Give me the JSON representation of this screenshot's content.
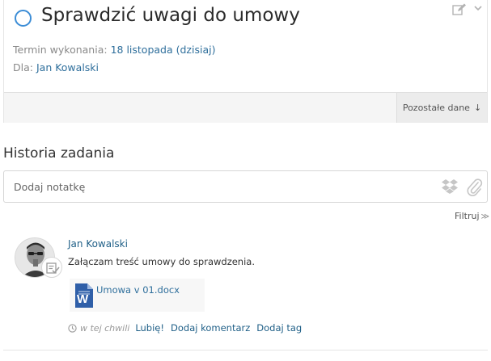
{
  "task": {
    "title": "Sprawdzić uwagi do umowy",
    "due_label": "Termin wykonania:",
    "due_value": "18 listopada (dzisiaj)",
    "for_label": "Dla:",
    "for_value": "Jan Kowalski",
    "more_data_label": "Pozostałe dane",
    "more_data_arrow": "↓"
  },
  "history": {
    "title": "Historia zadania",
    "note_placeholder": "Dodaj notatkę",
    "filter_label": "Filtruj",
    "filter_chevron": "≫"
  },
  "entry": {
    "author": "Jan Kowalski",
    "text": "Załączam treść umowy do sprawdzenia.",
    "attachment_name": "Umowa v 01.docx",
    "time": "w tej chwili",
    "like_label": "Lubię!",
    "comment_label": "Dodaj komentarz",
    "tag_label": "Dodaj tag"
  },
  "icons": {
    "complete": "circle-checkbox-icon",
    "edit": "edit-icon",
    "more": "more-icon",
    "dropbox": "dropbox-icon",
    "attach": "paperclip-icon",
    "word": "word-doc-icon",
    "clock": "clock-icon"
  },
  "colors": {
    "link": "#2f6f9c",
    "accent": "#3c8dd6",
    "muted": "#8a8a8a"
  }
}
